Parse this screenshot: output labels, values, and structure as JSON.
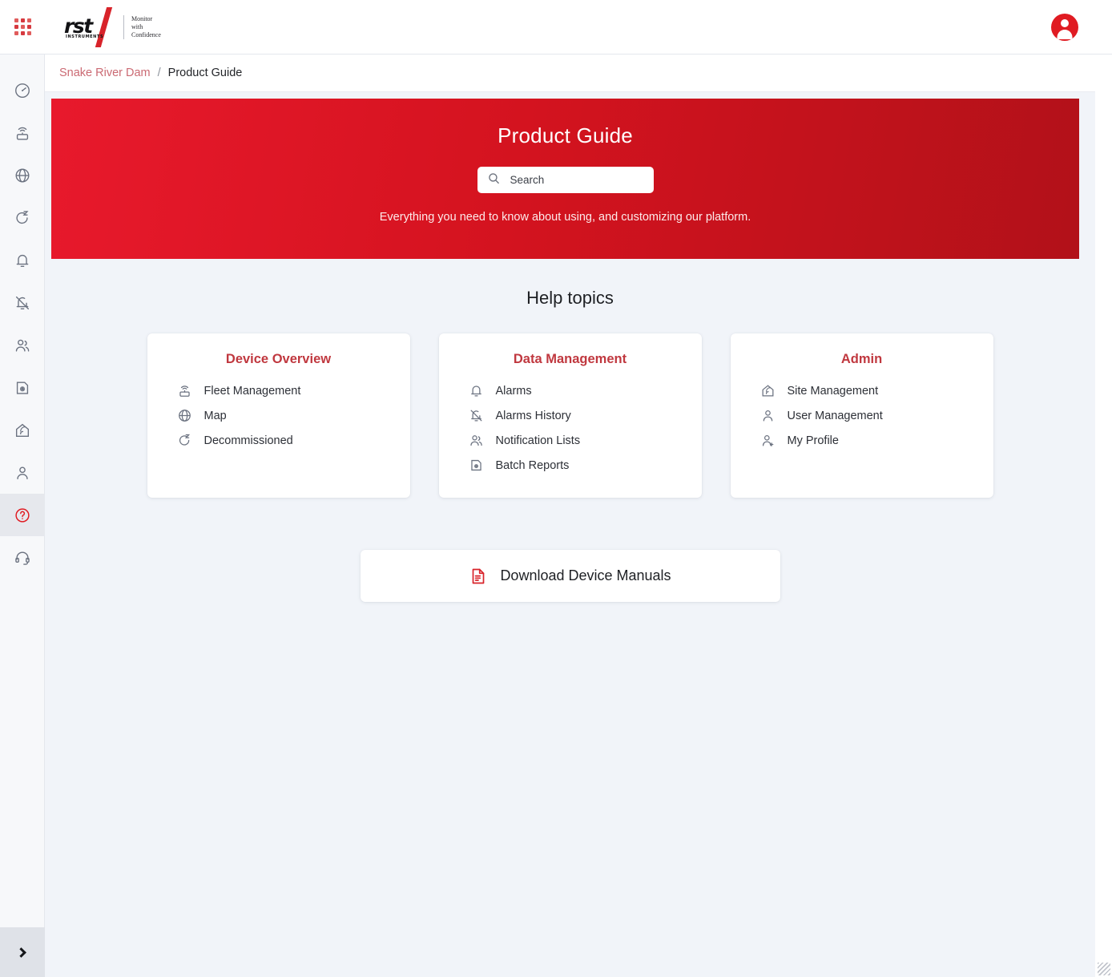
{
  "topbar": {
    "apps_grid_label": "apps-grid",
    "logo": {
      "wordmark": "rst",
      "subword": "INSTRUMENTS",
      "tagline_line1": "Monitor",
      "tagline_line2": "with",
      "tagline_line3": "Confidence"
    },
    "avatar_label": "User account"
  },
  "sidebar": {
    "items": [
      {
        "name": "dashboard",
        "icon": "gauge-icon",
        "active": false
      },
      {
        "name": "fleet-management",
        "icon": "router-signal-icon",
        "active": false
      },
      {
        "name": "map",
        "icon": "globe-icon",
        "active": false
      },
      {
        "name": "decommissioned",
        "icon": "refresh-sleep-icon",
        "active": false
      },
      {
        "name": "alarms",
        "icon": "bell-icon",
        "active": false
      },
      {
        "name": "alarms-history",
        "icon": "bell-off-icon",
        "active": false
      },
      {
        "name": "notification-lists",
        "icon": "users-icon",
        "active": false
      },
      {
        "name": "batch-reports",
        "icon": "file-clock-icon",
        "active": false
      },
      {
        "name": "site-management",
        "icon": "home-signal-icon",
        "active": false
      },
      {
        "name": "user-management",
        "icon": "user-icon",
        "active": false
      },
      {
        "name": "product-guide",
        "icon": "help-circle-icon",
        "active": true
      },
      {
        "name": "support",
        "icon": "headset-icon",
        "active": false
      }
    ],
    "expand_label": "expand-sidebar"
  },
  "breadcrumb": {
    "site": "Snake River Dam",
    "separator": "/",
    "current": "Product Guide"
  },
  "hero": {
    "title": "Product Guide",
    "search_placeholder": "Search",
    "search_value": "",
    "subtitle": "Everything you need to know about using, and customizing our platform.",
    "gradient_from": "#e8192c",
    "gradient_to": "#b21119"
  },
  "main": {
    "section_heading": "Help topics",
    "cards": [
      {
        "title": "Device Overview",
        "items": [
          {
            "label": "Fleet Management",
            "icon": "router-signal-icon"
          },
          {
            "label": "Map",
            "icon": "globe-icon"
          },
          {
            "label": "Decommissioned",
            "icon": "refresh-sleep-icon"
          }
        ]
      },
      {
        "title": "Data Management",
        "items": [
          {
            "label": "Alarms",
            "icon": "bell-icon"
          },
          {
            "label": "Alarms History",
            "icon": "bell-off-icon"
          },
          {
            "label": "Notification Lists",
            "icon": "users-icon"
          },
          {
            "label": "Batch Reports",
            "icon": "file-clock-icon"
          }
        ]
      },
      {
        "title": "Admin",
        "items": [
          {
            "label": "Site Management",
            "icon": "home-signal-icon"
          },
          {
            "label": "User Management",
            "icon": "user-icon"
          },
          {
            "label": "My Profile",
            "icon": "user-plus-icon"
          }
        ]
      }
    ],
    "download": {
      "label": "Download Device Manuals",
      "icon": "document-red-icon"
    }
  },
  "colors": {
    "brand_red": "#e01b22",
    "card_title_red": "#c0383f",
    "page_background": "#f1f4f9",
    "sidebar_background": "#f7f8fa"
  }
}
